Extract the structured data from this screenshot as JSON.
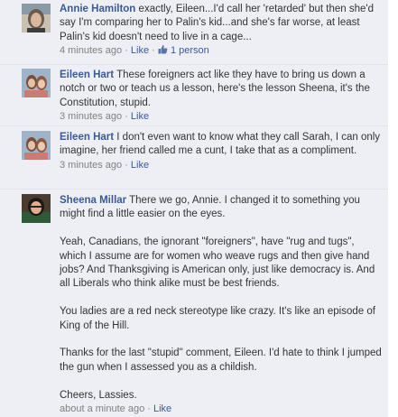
{
  "comments": [
    {
      "author": "Annie Hamilton",
      "text": "exactly, Eileen...I'd call her 'retarded' but then she'd say I'm comparing her to Palin's kid...and she's far worse, at least Palin's kid doesn't need to live in a cage...",
      "time": "4 minutes ago",
      "like_label": "Like",
      "likes_count": "1 person"
    },
    {
      "author": "Eileen Hart",
      "text": "These foreigners act like they have to bring us down a notch or two or teach us a lesson, here's the lesson Sheena, it's the Constitution, stupid.",
      "time": "3 minutes ago",
      "like_label": "Like"
    },
    {
      "author": "Eileen Hart",
      "text": "I don't even want to know what they call Sarah, I can only imagine, her friend called me a cunt, I take that as a compliment.",
      "time": "3 minutes ago",
      "like_label": "Like"
    },
    {
      "author": "Sheena Millar",
      "paragraphs": [
        "There we go, Annie. I changed it to something you might find a little easier on the eyes.",
        "Yeah, Canadians, the ignorant \"foreigners\", have \"rug and tugs\", which I assume are for women who weave rugs and then give hand jobs? And Thanksgiving is American only, just like democracy is. And all Liberals who think alike must be best friends.",
        "You ladies are a red neck stereotype like crazy. It's like an episode of King of the Hill.",
        "Thanks for the last \"stupid\" comment, Eileen. I'd hate to think I jumped the gun when I assessed you as a childish.",
        "Cheers, Lassies."
      ],
      "time": "about a minute ago",
      "like_label": "Like"
    }
  ],
  "separator": "·",
  "colors": {
    "background": "#edeff4",
    "link": "#3b5998",
    "text": "#333333",
    "meta": "#808080"
  },
  "icons": {
    "thumbs_up": "thumbs-up-icon"
  }
}
